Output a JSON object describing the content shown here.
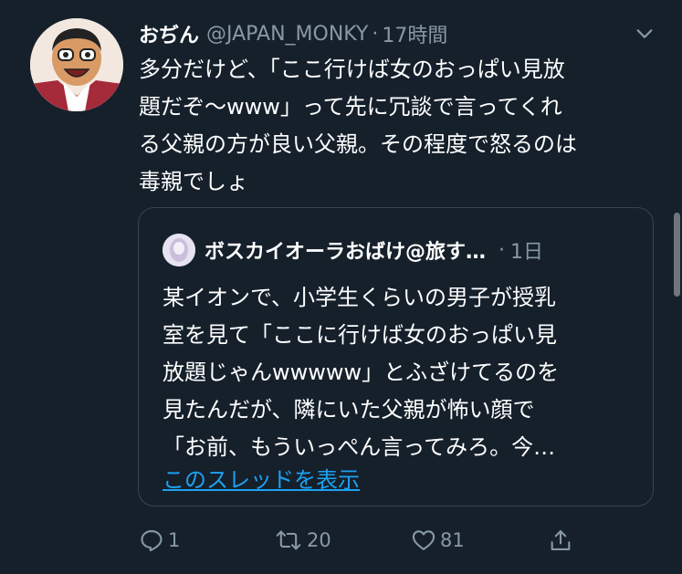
{
  "tweet": {
    "author_name": "おぢん",
    "author_handle": "@JAPAN_MONKY",
    "separator": "·",
    "time": "17時間",
    "text_lines": [
      "多分だけど、「ここ行けば女のおっぱい見放",
      "題だぞ〜www」って先に冗談で言ってくれ",
      "る父親の方が良い父親。その程度で怒るのは",
      "毒親でしょ"
    ]
  },
  "quote": {
    "author_name": "ボスカイオーラおばけ@旅す…",
    "separator": "·",
    "time": "1日",
    "text_lines": [
      "某イオンで、小学生くらいの男子が授乳",
      "室を見て「ここに行けば女のおっぱい見",
      "放題じゃんwwwww」とふざけてるのを",
      "見たんだが、隣にいた父親が怖い顔で",
      "「お前、もういっぺん言ってみろ。今…"
    ],
    "show_thread_link": "このスレッドを表示"
  },
  "actions": {
    "reply_count": "1",
    "retweet_count": "20",
    "like_count": "81"
  },
  "icons": {
    "menu": "chevron-down-icon",
    "reply": "reply-icon",
    "retweet": "retweet-icon",
    "like": "heart-icon",
    "share": "share-icon"
  },
  "colors": {
    "background": "#15202b",
    "secondary_text": "#8899a6",
    "link": "#1da1f2",
    "border": "#38444d"
  }
}
